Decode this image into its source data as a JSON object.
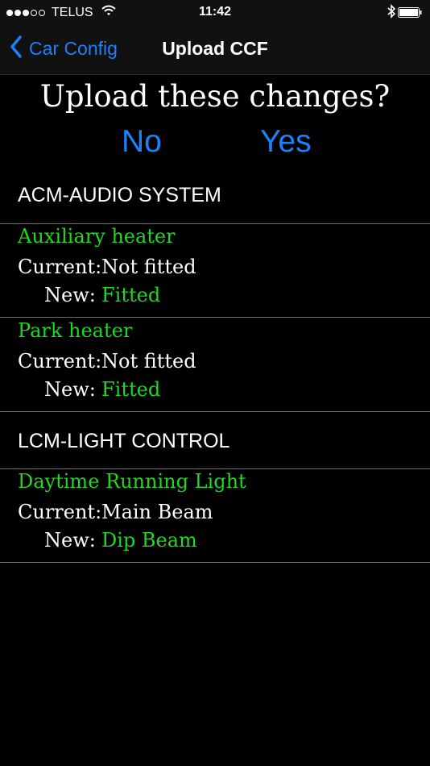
{
  "status_bar": {
    "carrier": "TELUS",
    "time": "11:42",
    "signal_bars_filled": 3,
    "signal_bars_total": 5
  },
  "nav": {
    "back_label": "Car Config",
    "title": "Upload CCF"
  },
  "prompt": {
    "question": "Upload these changes?",
    "no_label": "No",
    "yes_label": "Yes"
  },
  "labels": {
    "current": "Current:",
    "new": "New:"
  },
  "sections": [
    {
      "header": "ACM-AUDIO SYSTEM",
      "items": [
        {
          "title": "Auxiliary heater",
          "current": "Not fitted",
          "new": "Fitted"
        },
        {
          "title": "Park heater",
          "current": "Not fitted",
          "new": "Fitted"
        }
      ]
    },
    {
      "header": "LCM-LIGHT CONTROL",
      "items": [
        {
          "title": "Daytime Running Light",
          "current": "Main Beam",
          "new": "Dip Beam"
        }
      ]
    }
  ],
  "colors": {
    "accent_blue": "#1a82fb",
    "changed_green": "#1ed91e",
    "background": "#000000"
  }
}
